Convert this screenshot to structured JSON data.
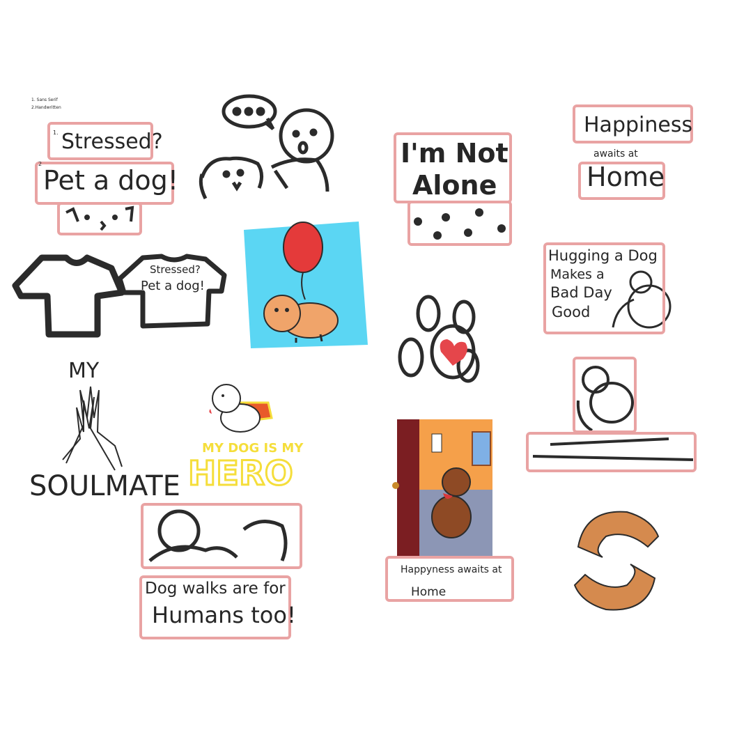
{
  "notes": {
    "line1": "1. Sans Serif",
    "line2": "2.Handwritten"
  },
  "stressed": {
    "line1": "Stressed?",
    "line2": "Pet a dog!",
    "num1": "1.",
    "num2": "2"
  },
  "shirt": {
    "line1": "Stressed?",
    "line2": "Pet a dog!"
  },
  "alone": {
    "line1": "I'm Not",
    "line2": "Alone"
  },
  "happiness_top": {
    "line1": "Happiness",
    "line2": "awaits at",
    "line3": "Home"
  },
  "hugging": {
    "line1": "Hugging a Dog",
    "line2": "Makes a",
    "line3": "Bad Day",
    "line4": "Good"
  },
  "soulmate": {
    "top": "MY",
    "bottom": "SOULMATE"
  },
  "hero": {
    "line1": "MY DOG IS MY",
    "line2": "HERO"
  },
  "walks": {
    "line1": "Dog walks are for",
    "line2": "Humans too!"
  },
  "door": {
    "line1": "Happyness awaits at",
    "line2": "Home"
  },
  "colors": {
    "accent_box": "#e9a3a3",
    "sky": "#5bd6f3",
    "balloon": "#e43a3a",
    "dog": "#f0a46a",
    "hero_yellow": "#f5de3b",
    "heart": "#e5464b"
  }
}
